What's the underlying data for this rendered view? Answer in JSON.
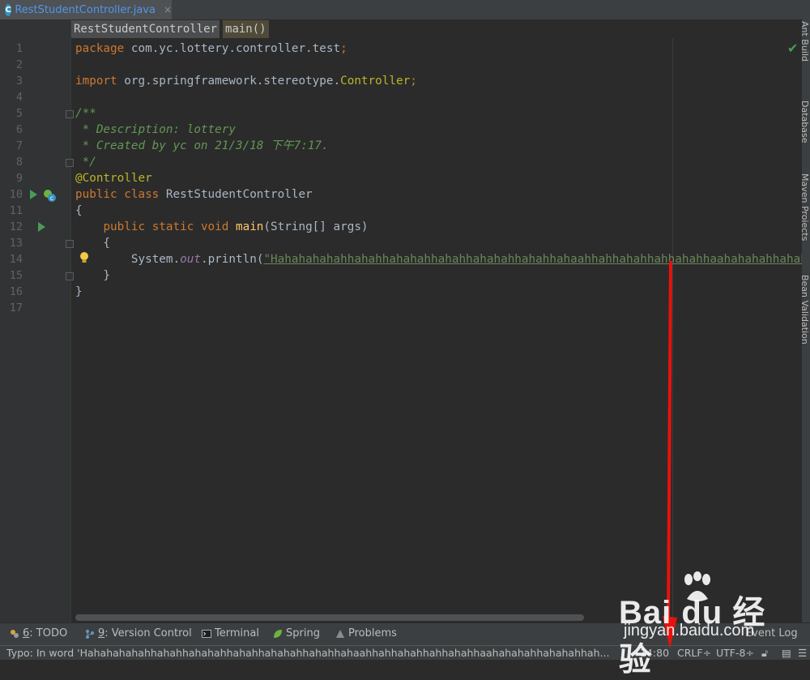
{
  "tab": {
    "filename": "RestStudentController.java",
    "icon_letter": "C",
    "close": "×"
  },
  "breadcrumb": [
    "RestStudentController",
    "main()"
  ],
  "line_numbers": [
    "1",
    "2",
    "3",
    "4",
    "5",
    "6",
    "7",
    "8",
    "9",
    "10",
    "11",
    "12",
    "13",
    "14",
    "15",
    "16",
    "17"
  ],
  "code": {
    "l1_kw": "package",
    "l1_rest": " com.yc.lottery.controller.test",
    "l3_kw": "import",
    "l3_pkg": " org.springframework.stereotype.",
    "l3_cls": "Controller",
    "semi": ";",
    "l5": "/**",
    "l6": " * Description: lottery",
    "l7": " * Created by yc on 21/3/18 下午7:17.",
    "l8": " */",
    "l9": "@Controller",
    "l10_kw": "public class",
    "l10_rest": " RestStudentController",
    "l11": "{",
    "l12_indent": "    ",
    "l12_kw": "public static void",
    "l12_sp": " ",
    "l12_fn": "main",
    "l12_rest": "(String[] args)",
    "l13": "    {",
    "l14_indent": "        ",
    "l14_a": "System.",
    "l14_out": "out",
    "l14_b": ".println(",
    "l14_str": "\"Hahahahahahhahahhahahahhahahhahahahhahahhahaahhahhahahhahhahahhaahahahahhahaha",
    "l15": "    }",
    "l16": "}"
  },
  "right_tools": [
    "Ant Build",
    "Database",
    "Maven Projects",
    "Bean Validation"
  ],
  "tool_windows": {
    "todo_num": "6",
    "todo_label": ": TODO",
    "vc_num": "9",
    "vc_label": ": Version Control",
    "terminal": "Terminal",
    "spring": "Spring",
    "problems": "Problems",
    "event_log": "Event Log"
  },
  "status": {
    "message": "Typo: In word 'Hahahahahahhahahhahahahhahahhahahahhahahhahaahhahhahahhahhahahhaahahahahhahahahhah...",
    "position": "14:80",
    "line_sep": "CRLF÷",
    "encoding": "UTF-8÷"
  },
  "watermark": {
    "logo": "Bai du 经验",
    "url": "jingyan.baidu.com"
  },
  "colors": {
    "keyword": "#cc7832",
    "annotation": "#bbb529",
    "comment": "#629755",
    "string": "#6a8759",
    "arrow": "#e8120c"
  }
}
